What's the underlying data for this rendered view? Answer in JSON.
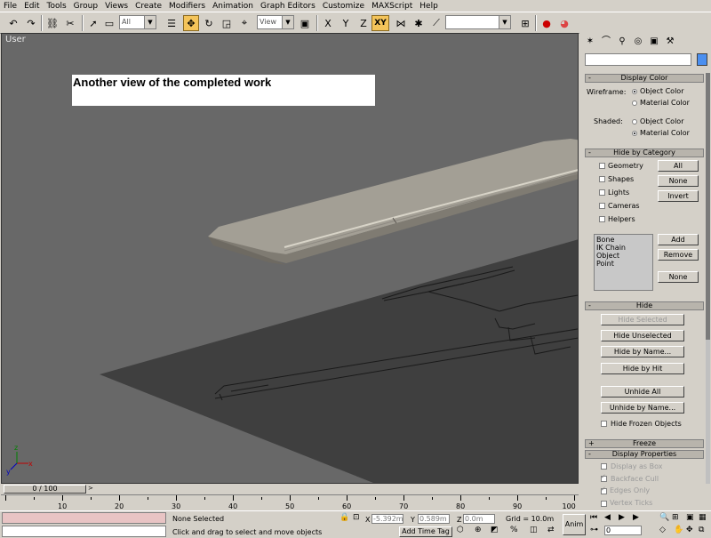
{
  "menu": [
    "File",
    "Edit",
    "Tools",
    "Group",
    "Views",
    "Create",
    "Modifiers",
    "Animation",
    "Graph Editors",
    "Customize",
    "MAXScript",
    "Help"
  ],
  "toolbar": {
    "selection_filter": "All",
    "ref_coord": "View",
    "axis_label": "XY",
    "named_selection": ""
  },
  "viewport": {
    "label": "User",
    "caption": "Another view of the completed work",
    "axis_x": "x",
    "axis_y": "y",
    "axis_z": "z"
  },
  "command_panel": {
    "display_color": {
      "title": "Display Color",
      "wireframe_label": "Wireframe:",
      "shaded_label": "Shaded:",
      "object_color": "Object Color",
      "material_color": "Material Color",
      "wireframe_selected": "object",
      "shaded_selected": "material"
    },
    "hide_by_category": {
      "title": "Hide by Category",
      "categories": [
        "Geometry",
        "Shapes",
        "Lights",
        "Cameras",
        "Helpers"
      ],
      "all_btn": "All",
      "none_btn": "None",
      "invert_btn": "Invert",
      "list": [
        "Bone",
        "IK Chain Object",
        "Point"
      ],
      "add_btn": "Add",
      "remove_btn": "Remove",
      "none2_btn": "None"
    },
    "hide": {
      "title": "Hide",
      "hide_selected": "Hide Selected",
      "hide_unselected": "Hide Unselected",
      "hide_by_name": "Hide by Name...",
      "hide_by_hit": "Hide by Hit",
      "unhide_all": "Unhide All",
      "unhide_by_name": "Unhide by Name...",
      "hide_frozen": "Hide Frozen Objects"
    },
    "freeze": {
      "title": "Freeze"
    },
    "display_properties": {
      "title": "Display Properties",
      "items": [
        {
          "label": "Display as Box",
          "checked": false
        },
        {
          "label": "Backface Cull",
          "checked": true
        },
        {
          "label": "Edges Only",
          "checked": true
        },
        {
          "label": "Vertex Ticks",
          "checked": false
        }
      ]
    }
  },
  "timeline": {
    "frame": "0 / 100",
    "ticks": [
      "10",
      "20",
      "30",
      "40",
      "50",
      "60",
      "70",
      "80",
      "90",
      "100"
    ]
  },
  "status": {
    "selection": "None Selected",
    "prompt": "Click and drag to select and move objects",
    "x_label": "X",
    "x_value": "-5.392m",
    "y_label": "Y",
    "y_value": "0.589m",
    "z_label": "Z",
    "z_value": "0.0m",
    "grid": "Grid = 10.0m",
    "add_time_tag": "Add Time Tag",
    "anim": "Anim",
    "frame_value": "0"
  },
  "colors": {
    "viewport_bg": "#686868",
    "ui_gray": "#d4d0c8",
    "active_tool": "#f4c45a",
    "object_color_swatch": "#4a8ff0"
  }
}
